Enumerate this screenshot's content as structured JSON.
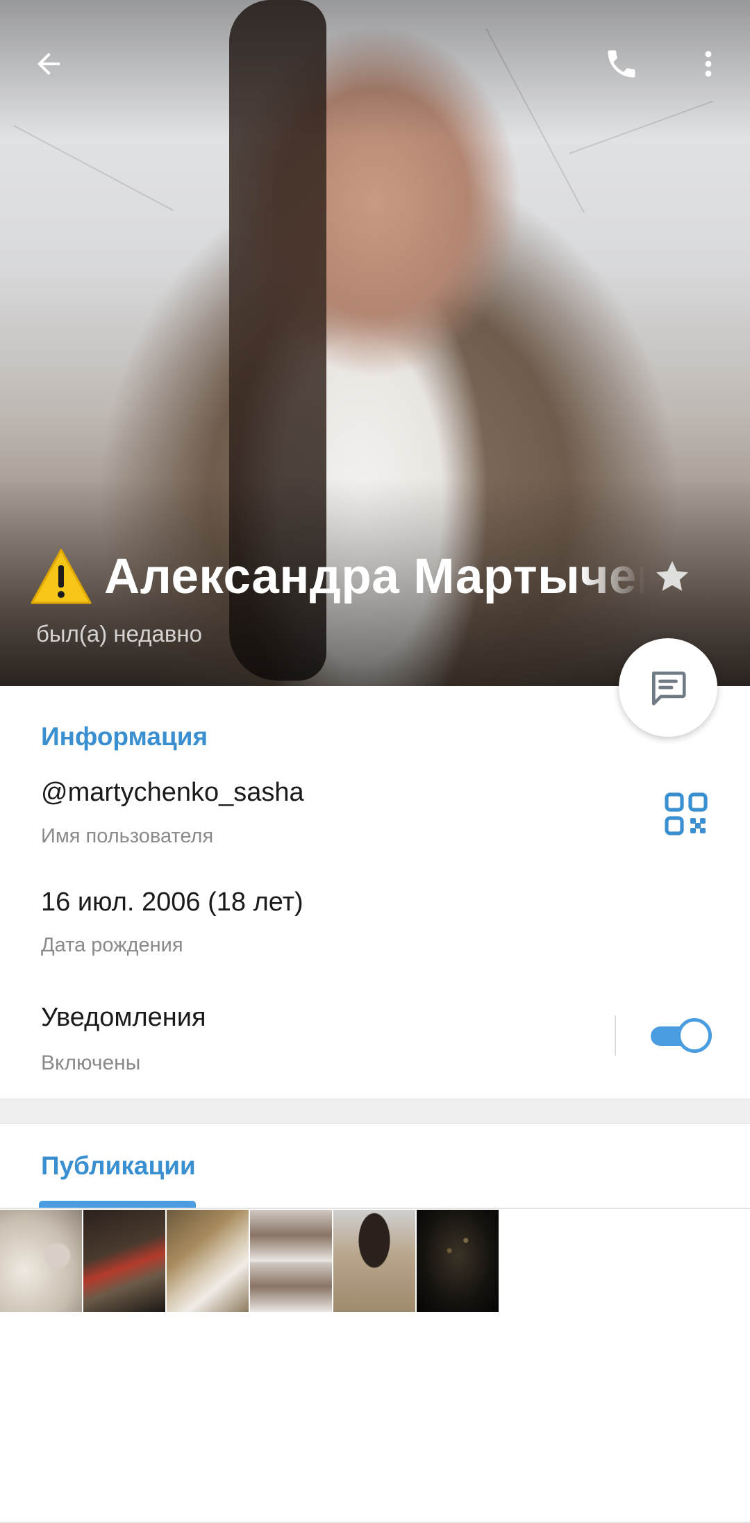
{
  "header": {
    "name": "Александра Мартыченко",
    "status": "был(а) недавно",
    "icons": {
      "back": "arrow-left-icon",
      "call": "phone-icon",
      "more": "more-vertical-icon",
      "warning": "warning-icon",
      "star": "star-icon",
      "message": "message-icon"
    }
  },
  "info": {
    "section_title": "Информация",
    "username": "@martychenko_sasha",
    "username_label": "Имя пользователя",
    "birthday": "16 июл. 2006 (18 лет)",
    "birthday_label": "Дата рождения",
    "notifications": "Уведомления",
    "notifications_status": "Включены",
    "notifications_enabled": true
  },
  "publications": {
    "tab_label": "Публикации",
    "thumbnails": [
      "thumb-1",
      "thumb-2",
      "thumb-3",
      "thumb-4",
      "thumb-5",
      "thumb-6"
    ]
  },
  "colors": {
    "accent": "#3a8fd1",
    "toggle": "#4a9de0",
    "text_primary": "#1a1a1a",
    "text_secondary": "#8a8a8a"
  }
}
